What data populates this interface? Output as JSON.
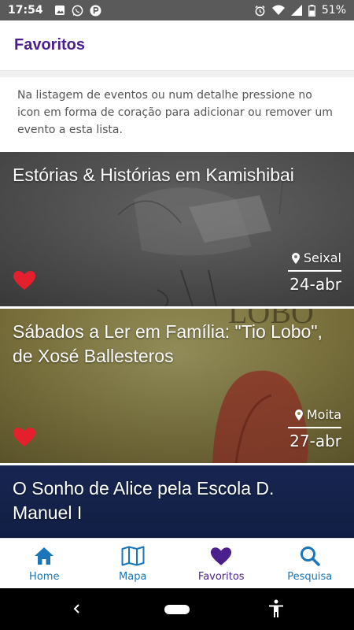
{
  "status_bar": {
    "time": "17:54",
    "battery": "51%",
    "icons": [
      "image-icon",
      "whatsapp-icon",
      "parking-icon",
      "alarm-icon",
      "wifi-icon",
      "signal-icon",
      "battery-icon"
    ]
  },
  "header": {
    "title": "Favoritos"
  },
  "info_text": "Na listagem de eventos ou num detalhe pressione no icon em forma de coração para adicionar ou remover um evento a esta lista.",
  "events": [
    {
      "title": "Estórias & Histórias em Kamishibai",
      "location": "Seixal",
      "date": "24-abr",
      "favorite": true
    },
    {
      "title": "Sábados a Ler em Família: \"Tio Lobo\", de Xosé Ballesteros",
      "location": "Moita",
      "date": "27-abr",
      "favorite": true
    },
    {
      "title": "O Sonho de Alice pela Escola D. Manuel I"
    }
  ],
  "nav": {
    "items": [
      {
        "label": "Home",
        "icon": "home-icon"
      },
      {
        "label": "Mapa",
        "icon": "map-icon"
      },
      {
        "label": "Favoritos",
        "icon": "heart-icon",
        "active": true
      },
      {
        "label": "Pesquisa",
        "icon": "search-icon"
      }
    ]
  },
  "colors": {
    "brand": "#4b1f8c",
    "accent": "#1a75bb",
    "heart": "#e5202d"
  }
}
